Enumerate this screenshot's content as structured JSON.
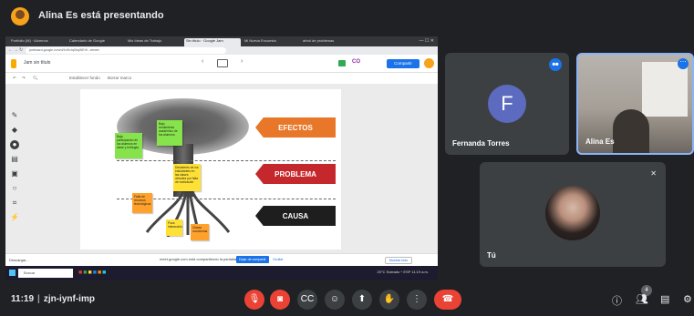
{
  "header": {
    "presenting_title": "Alina Es está presentando"
  },
  "shared_screen": {
    "browser": {
      "tabs": [
        "Portfolio (M) · Alumnos",
        "Calendario de Google",
        "Mis Ideas de Trabajo",
        "Sin título · Google Jam",
        "Mi Nueva Encuesta",
        "árbol de problemas"
      ],
      "url": "jamboard.google.com/d/1rWvIqOkqWEr9...viewer"
    },
    "jamboard": {
      "title": "Jam sin título",
      "toolbar_items": [
        "Establecer fondo",
        "Borrar marco"
      ],
      "share_label": "Compartir",
      "tools": [
        "pen",
        "eraser",
        "select",
        "sticky-note",
        "image",
        "circle",
        "text-box",
        "laser"
      ],
      "banners": {
        "efectos": "EFECTOS",
        "problema": "PROBLEMA",
        "causa": "CAUSA"
      },
      "stickies": {
        "green_left": "Baja participación de los alumnos en clase y entregas",
        "green_top": "Bajo rendimiento académico de los alumnos",
        "yellow_trunk": "Desinterés de los estudiantes en las clases virtuales por falta de motivación",
        "orange_left": "Falta de recursos tecnológicos",
        "yellow_bottom": "Poca interacción",
        "orange_bottom": "Clases monótonas"
      }
    },
    "share_notice": {
      "text": "meet.google.com está compartiendo la pantalla",
      "stop_label": "Dejar de compartir",
      "hide_label": "Ocultar"
    },
    "download": {
      "item": "Descargar...",
      "show_all": "Mostrar todo"
    },
    "taskbar": {
      "search_placeholder": "Buscar",
      "tray": "20°C Soleado  ^  ESP  11:19 a.m."
    }
  },
  "participants": [
    {
      "name": "Fernanda Torres",
      "initial": "F"
    },
    {
      "name": "Alina Es"
    },
    {
      "name": "Tú"
    }
  ],
  "bottom": {
    "time": "11:19",
    "meeting_code": "zjn-iynf-imp",
    "people_count": "4"
  },
  "colors": {
    "efectos": "#e8772a",
    "problema": "#c4282d",
    "causa": "#1e1e1e",
    "meet_red": "#ea4335",
    "accent_blue": "#1a73e8"
  }
}
